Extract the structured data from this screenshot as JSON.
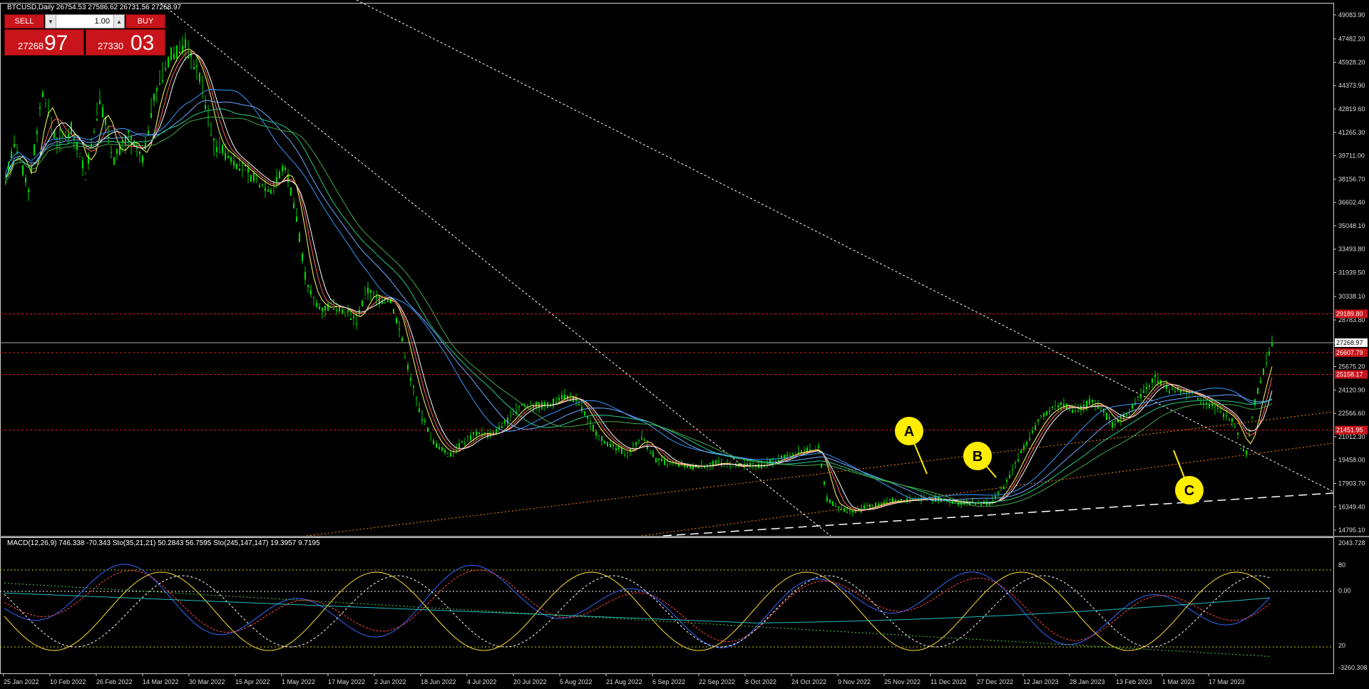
{
  "header": {
    "symbol_info": "BTCUSD,Daily  26754.53 27586.62 26731.56 27268.97"
  },
  "trade_panel": {
    "sell_label": "SELL",
    "buy_label": "BUY",
    "lot": "1.00",
    "bid_small": "27268",
    "bid_big": "97",
    "ask_small": "27330",
    "ask_big": "03"
  },
  "indicator_label": "MACD(12,26,9) 746.338 -70.343  Sto(35,21,21) 50.2843 56.7595  Sto(245,147,147) 19.3957 9.7195",
  "price_axis": [
    "49083.90",
    "47482.20",
    "45928.20",
    "44373.90",
    "42819.60",
    "41265.30",
    "39711.00",
    "38156.70",
    "36602.40",
    "35048.10",
    "33493.80",
    "31939.50",
    "30338.10",
    "28783.80",
    "27268.97",
    "25675.20",
    "24120.90",
    "22566.60",
    "21012.30",
    "19458.00",
    "17903.70",
    "16349.40",
    "14795.10"
  ],
  "price_tags": [
    {
      "label": "29189.80",
      "kind": "red"
    },
    {
      "label": "27268.97",
      "kind": "current"
    },
    {
      "label": "26607.79",
      "kind": "red"
    },
    {
      "label": "25158.17",
      "kind": "red"
    },
    {
      "label": "21451.95",
      "kind": "red"
    }
  ],
  "indicator_axis": [
    "2043.728",
    "80",
    "0.00",
    "20",
    "-3260.308"
  ],
  "date_axis": [
    "25 Jan 2022",
    "10 Feb 2022",
    "26 Feb 2022",
    "14 Mar 2022",
    "30 Mar 2022",
    "15 Apr 2022",
    "1 May 2022",
    "17 May 2022",
    "2 Jun 2022",
    "18 Jun 2022",
    "4 Jul 2022",
    "20 Jul 2022",
    "5 Aug 2022",
    "21 Aug 2022",
    "6 Sep 2022",
    "22 Sep 2022",
    "8 Oct 2022",
    "24 Oct 2022",
    "9 Nov 2022",
    "25 Nov 2022",
    "11 Dec 2022",
    "27 Dec 2022",
    "12 Jan 2023",
    "28 Jan 2023",
    "13 Feb 2023",
    "1 Mar 2023",
    "17 Mar 2023"
  ],
  "annotations": [
    "A",
    "B",
    "C"
  ],
  "colors": {
    "background": "#000000",
    "candles": "#00cc00",
    "accent_red": "#c8141a",
    "callout": "#ffee00"
  }
}
